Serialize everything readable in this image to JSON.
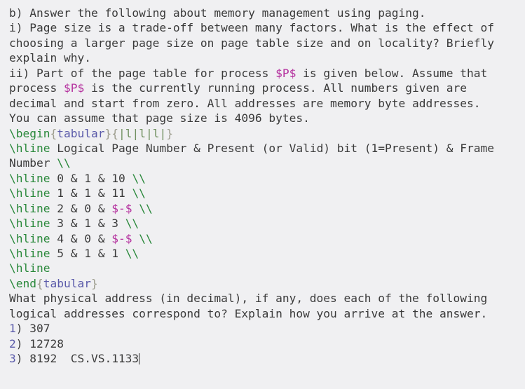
{
  "document": {
    "kind": "latex-source",
    "background_color": "#f0f0f2",
    "text_color": "#3a3a3a",
    "command_color": "#29883a",
    "brace_color": "#9d9d8e",
    "environment_color": "#5b5baa",
    "math_color": "#b4309e",
    "number_color": "#5b5baa"
  },
  "lines": [
    {
      "id": "line-1",
      "tokens": [
        {
          "t": "plain",
          "s": "b) Answer the following about memory management using paging."
        }
      ]
    },
    {
      "id": "line-2",
      "tokens": [
        {
          "t": "plain",
          "s": "i) Page size is a trade-off between many factors. What is the effect of"
        }
      ]
    },
    {
      "id": "line-3",
      "tokens": [
        {
          "t": "plain",
          "s": "choosing a larger page size on page table size and on locality? Briefly"
        }
      ]
    },
    {
      "id": "line-4",
      "tokens": [
        {
          "t": "plain",
          "s": "explain why."
        }
      ]
    },
    {
      "id": "line-5",
      "tokens": [
        {
          "t": "plain",
          "s": "ii) Part of the page table for process "
        },
        {
          "t": "math",
          "s": "$P$"
        },
        {
          "t": "plain",
          "s": " is given below. Assume that"
        }
      ]
    },
    {
      "id": "line-6",
      "tokens": [
        {
          "t": "plain",
          "s": "process "
        },
        {
          "t": "math",
          "s": "$P$"
        },
        {
          "t": "plain",
          "s": " is the currently running process. All numbers given are"
        }
      ]
    },
    {
      "id": "line-7",
      "tokens": [
        {
          "t": "plain",
          "s": "decimal and start from zero. All addresses are memory byte addresses."
        }
      ]
    },
    {
      "id": "line-8",
      "tokens": [
        {
          "t": "plain",
          "s": "You can assume that page size is 4096 bytes."
        }
      ]
    },
    {
      "id": "line-9",
      "tokens": [
        {
          "t": "cmd",
          "s": "\\begin"
        },
        {
          "t": "brace",
          "s": "{"
        },
        {
          "t": "env",
          "s": "tabular"
        },
        {
          "t": "brace",
          "s": "}"
        },
        {
          "t": "brace",
          "s": "{"
        },
        {
          "t": "spec",
          "s": "|l|l|l|"
        },
        {
          "t": "brace",
          "s": "}"
        }
      ]
    },
    {
      "id": "line-10",
      "tokens": [
        {
          "t": "cmd",
          "s": "\\hline"
        },
        {
          "t": "plain",
          "s": " Logical Page Number & Present (or Valid) bit (1=Present) & Frame"
        }
      ]
    },
    {
      "id": "line-11",
      "tokens": [
        {
          "t": "plain",
          "s": "Number "
        },
        {
          "t": "cmd",
          "s": "\\\\"
        }
      ]
    },
    {
      "id": "line-12",
      "tokens": [
        {
          "t": "cmd",
          "s": "\\hline"
        },
        {
          "t": "plain",
          "s": " 0 & 1 & 10 "
        },
        {
          "t": "cmd",
          "s": "\\\\"
        }
      ]
    },
    {
      "id": "line-13",
      "tokens": [
        {
          "t": "cmd",
          "s": "\\hline"
        },
        {
          "t": "plain",
          "s": " 1 & 1 & 11 "
        },
        {
          "t": "cmd",
          "s": "\\\\"
        }
      ]
    },
    {
      "id": "line-14",
      "tokens": [
        {
          "t": "cmd",
          "s": "\\hline"
        },
        {
          "t": "plain",
          "s": " 2 & 0 & "
        },
        {
          "t": "math",
          "s": "$-$"
        },
        {
          "t": "plain",
          "s": " "
        },
        {
          "t": "cmd",
          "s": "\\\\"
        }
      ]
    },
    {
      "id": "line-15",
      "tokens": [
        {
          "t": "cmd",
          "s": "\\hline"
        },
        {
          "t": "plain",
          "s": " 3 & 1 & 3 "
        },
        {
          "t": "cmd",
          "s": "\\\\"
        }
      ]
    },
    {
      "id": "line-16",
      "tokens": [
        {
          "t": "cmd",
          "s": "\\hline"
        },
        {
          "t": "plain",
          "s": " 4 & 0 & "
        },
        {
          "t": "math",
          "s": "$-$"
        },
        {
          "t": "plain",
          "s": " "
        },
        {
          "t": "cmd",
          "s": "\\\\"
        }
      ]
    },
    {
      "id": "line-17",
      "tokens": [
        {
          "t": "cmd",
          "s": "\\hline"
        },
        {
          "t": "plain",
          "s": " 5 & 1 & 1 "
        },
        {
          "t": "cmd",
          "s": "\\\\"
        }
      ]
    },
    {
      "id": "line-18",
      "tokens": [
        {
          "t": "cmd",
          "s": "\\hline"
        }
      ]
    },
    {
      "id": "line-19",
      "tokens": [
        {
          "t": "cmd",
          "s": "\\end"
        },
        {
          "t": "brace",
          "s": "{"
        },
        {
          "t": "env",
          "s": "tabular"
        },
        {
          "t": "brace",
          "s": "}"
        }
      ]
    },
    {
      "id": "line-20",
      "tokens": [
        {
          "t": "plain",
          "s": "What physical address (in decimal), if any, does each of the following"
        }
      ]
    },
    {
      "id": "line-21",
      "tokens": [
        {
          "t": "plain",
          "s": "logical addresses correspond to? Explain how you arrive at the answer."
        }
      ]
    },
    {
      "id": "line-22",
      "tokens": [
        {
          "t": "num",
          "s": "1"
        },
        {
          "t": "plain",
          "s": ") 307"
        }
      ]
    },
    {
      "id": "line-23",
      "tokens": [
        {
          "t": "num",
          "s": "2"
        },
        {
          "t": "plain",
          "s": ") 12728"
        }
      ]
    },
    {
      "id": "line-24",
      "tokens": [
        {
          "t": "num",
          "s": "3"
        },
        {
          "t": "plain",
          "s": ") 8192  CS.VS.1133"
        },
        {
          "t": "caret",
          "s": ""
        }
      ]
    }
  ]
}
